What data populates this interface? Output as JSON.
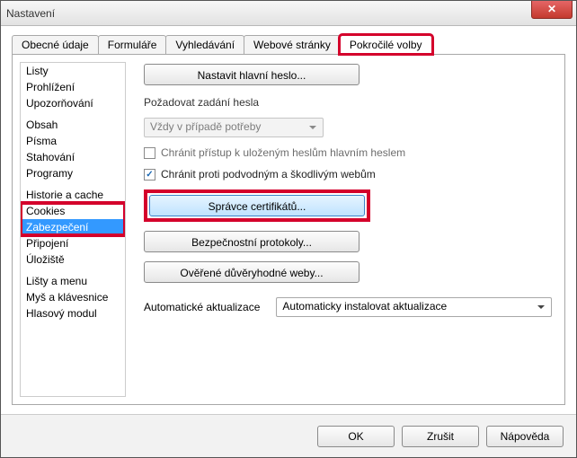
{
  "window": {
    "title": "Nastavení",
    "close_glyph": "✕"
  },
  "tabs": [
    {
      "label": "Obecné údaje"
    },
    {
      "label": "Formuláře"
    },
    {
      "label": "Vyhledávání"
    },
    {
      "label": "Webové stránky"
    },
    {
      "label": "Pokročilé volby",
      "active": true,
      "highlighted": true
    }
  ],
  "sidebar": {
    "groups": [
      [
        "Listy",
        "Prohlížení",
        "Upozorňování"
      ],
      [
        "Obsah",
        "Písma",
        "Stahování",
        "Programy"
      ],
      [
        "Historie a cache",
        "Cookies",
        "Zabezpečení",
        "Připojení",
        "Úložiště"
      ],
      [
        "Lišty a menu",
        "Myš a klávesnice",
        "Hlasový modul"
      ]
    ],
    "selected": "Zabezpečení"
  },
  "main": {
    "set_master_password": "Nastavit hlavní heslo...",
    "require_password_label": "Požadovat zadání hesla",
    "require_password_value": "Vždy v případě potřeby",
    "protect_stored_passwords": "Chránit přístup k uloženým heslům hlavním heslem",
    "protect_fraud": "Chránit proti podvodným a škodlivým webům",
    "cert_manager": "Správce certifikátů...",
    "security_protocols": "Bezpečnostní protokoly...",
    "verified_sites": "Ověřené důvěryhodné weby...",
    "auto_updates_label": "Automatické aktualizace",
    "auto_updates_value": "Automaticky instalovat aktualizace"
  },
  "footer": {
    "ok": "OK",
    "cancel": "Zrušit",
    "help": "Nápověda"
  }
}
